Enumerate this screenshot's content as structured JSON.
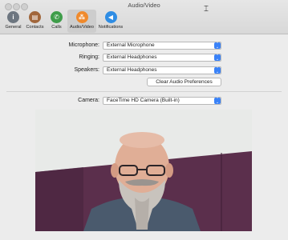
{
  "window": {
    "title": "Audio/Video"
  },
  "toolbar": {
    "tabs": [
      {
        "label": "General",
        "icon": "general-info-icon",
        "color": "#6d7680",
        "glyph": "i"
      },
      {
        "label": "Contacts",
        "icon": "contacts-book-icon",
        "color": "#a1663b",
        "glyph": "▤"
      },
      {
        "label": "Calls",
        "icon": "phone-icon",
        "color": "#3f9d4a",
        "glyph": "✆"
      },
      {
        "label": "Audio/Video",
        "icon": "audio-video-icon",
        "color": "#f08a2c",
        "glyph": "⁂"
      },
      {
        "label": "Notifications",
        "icon": "notifications-icon",
        "color": "#2f8de4",
        "glyph": "◀"
      }
    ],
    "selected": "Audio/Video"
  },
  "audio": {
    "microphone": {
      "label": "Microphone:",
      "value": "External Microphone"
    },
    "ringing": {
      "label": "Ringing:",
      "value": "External Headphones"
    },
    "speakers": {
      "label": "Speakers:",
      "value": "External Headphones"
    },
    "clear_button": "Clear Audio Preferences"
  },
  "video": {
    "camera": {
      "label": "Camera:",
      "value": "FaceTime HD Camera (Built-in)"
    }
  },
  "colors": {
    "accent": "#3a82f7",
    "window_bg": "#ececec",
    "wall": "#5b2f4c"
  }
}
